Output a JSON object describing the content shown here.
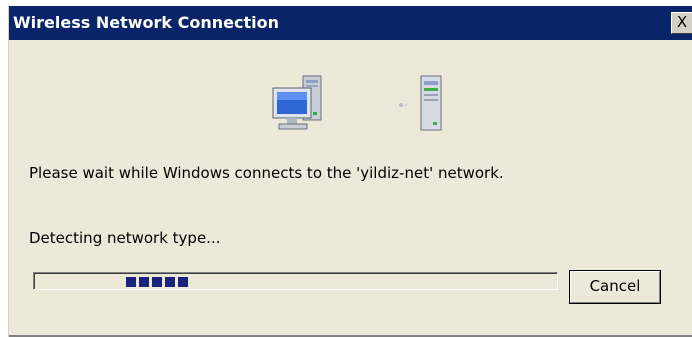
{
  "window": {
    "title": "Wireless Network Connection",
    "close_glyph": "X"
  },
  "icons": {
    "computer": "computer-icon",
    "connection": "connecting-dots-icon",
    "access_point": "server-icon"
  },
  "message": "Please wait while Windows connects to the 'yildiz-net' network.",
  "status": "Detecting network type...",
  "progress": {
    "mode": "marquee",
    "chunk_count": 5,
    "color": "#1a237e"
  },
  "buttons": {
    "cancel_label": "Cancel"
  },
  "colors": {
    "titlebar": "#0a246a",
    "dialog_bg": "#ece9d8"
  }
}
